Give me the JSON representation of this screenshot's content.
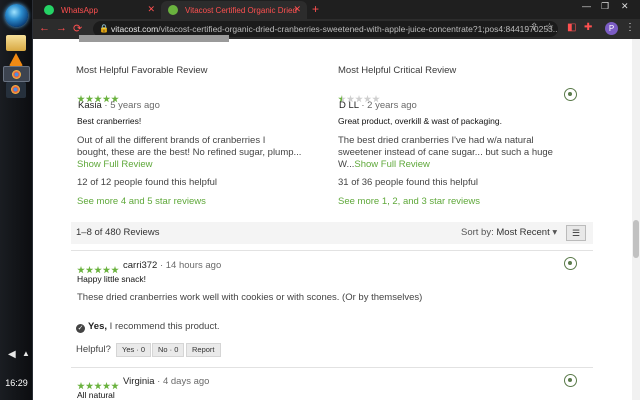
{
  "taskbar": {
    "clock": "16:29"
  },
  "browser": {
    "tabs": [
      {
        "label": "WhatsApp",
        "favicon_color": "#25d366"
      },
      {
        "label": "Vitacost Certified Organic Dried",
        "favicon_color": "#6ab23e"
      }
    ],
    "new_tab_label": "+",
    "url_host": "vitacost.com",
    "url_path": "/vitacost-certified-organic-dried-cranberries-sweetened-with-apple-juice-concentrate?1;pos4:8441970253...",
    "profile_initial": "P"
  },
  "highlights": {
    "favorable": {
      "heading": "Most Helpful Favorable Review",
      "rating": 5,
      "reviewer": "Kasia",
      "ago": "· 5 years ago",
      "title": "Best cranberries!",
      "body_1": "Out of all the different brands of cranberries I",
      "body_2": "bought, these are the best! No refined sugar, plump...",
      "show_full": "Show Full Review",
      "helpful": "12 of 12 people found this helpful",
      "see_more": "See more 4 and 5 star reviews"
    },
    "critical": {
      "heading": "Most Helpful Critical Review",
      "rating": 1,
      "reviewer": "D LL",
      "ago": "· 2 years ago",
      "title": "Great product, overkill & wast of packaging.",
      "body_1": "The best dried cranberries I've had w/a natural",
      "body_2": "sweetener instead of cane sugar... but such a huge",
      "body_3": "W...",
      "show_full": "Show Full Review",
      "helpful": "31 of 36 people found this helpful",
      "see_more": "See more 1, 2, and 3 star reviews"
    }
  },
  "sort_bar": {
    "count": "1–8 of 480 Reviews",
    "sort_label": "Sort by:",
    "sort_value": "Most Recent",
    "menu_icon": "☰"
  },
  "reviews": [
    {
      "rating": 5,
      "reviewer": "carri372",
      "ago": "· 14 hours ago",
      "title": "Happy little snack!",
      "body": "These dried cranberries work well with cookies or with scones. (Or by themselves)",
      "recommend_yes": "Yes,",
      "recommend_text": "I recommend this product.",
      "helpful_label": "Helpful?",
      "yes_btn": "Yes · 0",
      "no_btn": "No · 0",
      "report_btn": "Report"
    },
    {
      "rating": 5,
      "reviewer": "Virginia",
      "ago": "· 4 days ago",
      "title": "All natural"
    }
  ]
}
